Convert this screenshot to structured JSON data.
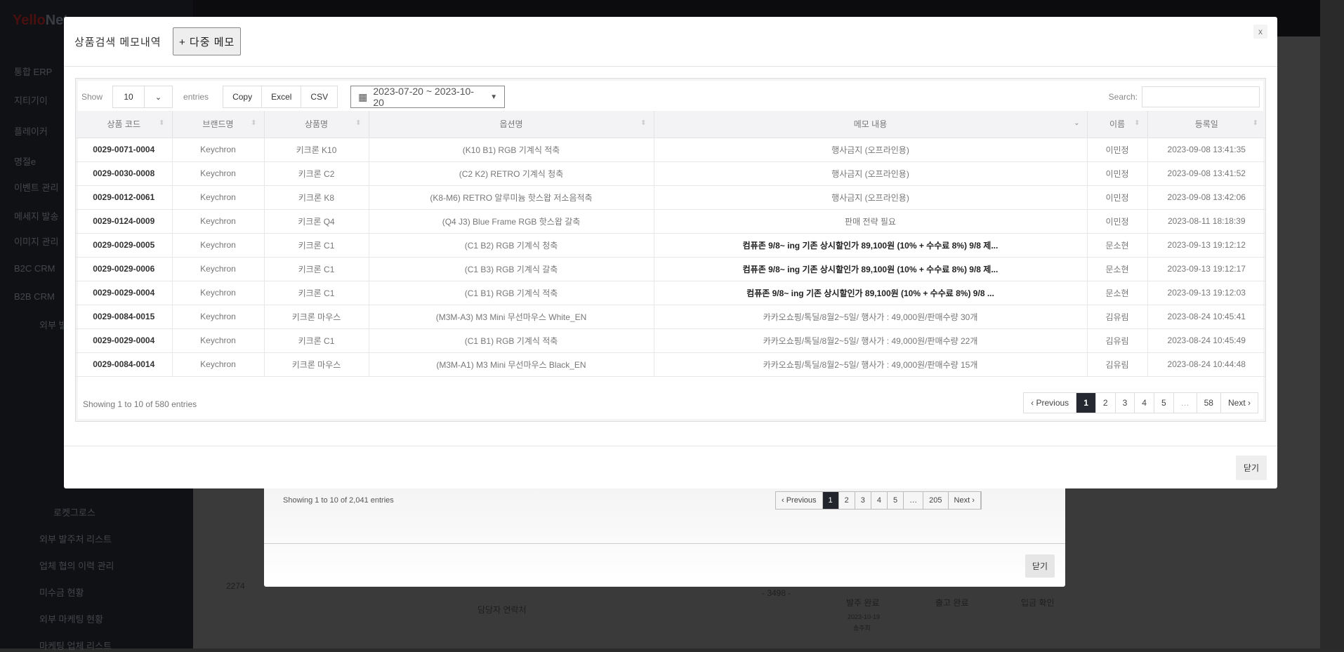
{
  "background": {
    "sidebar": [
      "통합 ERP",
      "지티기이",
      "플레이커",
      "명절e",
      "이벤트 관리",
      "메세지 발송",
      "이미지 관리",
      "B2C CRM",
      "B2B CRM",
      "외부 발주",
      "로켓그로스",
      "외부 발주처 리스트",
      "업체 협의 이력 관리",
      "미수금 현황",
      "외부 마케팅 현황",
      "마케팅 업체 리스트"
    ],
    "modal": {
      "info": "Showing 1 to 10 of 2,041 entries",
      "pages": [
        "‹ Previous",
        "1",
        "2",
        "3",
        "4",
        "5",
        "…",
        "205",
        "Next ›"
      ],
      "close": "닫기"
    },
    "row": {
      "id": "2274",
      "qty": "- 3498 -",
      "contact": "담당자 연락처",
      "s1": "발주 완료",
      "s2": "출고 완료",
      "s3": "입금 확인",
      "date": "2023-10-19",
      "person": "송주희"
    }
  },
  "modal": {
    "title": "상품검색 메모내역",
    "multi_memo": "+ 다중 메모",
    "close_x": "x",
    "show": "Show",
    "length": "10",
    "entries": "entries",
    "buttons": [
      "Copy",
      "Excel",
      "CSV"
    ],
    "daterange": "2023-07-20 ~ 2023-10-20",
    "search_label": "Search:",
    "columns": [
      "상품 코드",
      "브랜드명",
      "상품명",
      "옵션명",
      "메모 내용",
      "이름",
      "등록일"
    ],
    "rows": [
      [
        "0029-0071-0004",
        "Keychron",
        "키크론 K10",
        "(K10 B1) RGB 기계식 적축",
        "행사금지 (오프라인용)",
        "이민정",
        "2023-09-08 13:41:35"
      ],
      [
        "0029-0030-0008",
        "Keychron",
        "키크론 C2",
        "(C2 K2) RETRO 기계식 청축",
        "행사금지 (오프라인용)",
        "이민정",
        "2023-09-08 13:41:52"
      ],
      [
        "0029-0012-0061",
        "Keychron",
        "키크론 K8",
        "(K8-M6) RETRO 알루미늄 핫스왑 저소음적축",
        "행사금지 (오프라인용)",
        "이민정",
        "2023-09-08 13:42:06"
      ],
      [
        "0029-0124-0009",
        "Keychron",
        "키크론 Q4",
        "(Q4 J3) Blue Frame RGB 핫스왑 갈축",
        "판매 전략 필요",
        "이민정",
        "2023-08-11 18:18:39"
      ],
      [
        "0029-0029-0005",
        "Keychron",
        "키크론 C1",
        "(C1 B2) RGB 기계식 청축",
        "컴퓨존 9/8~ ing 기존 상시할인가 89,100원 (10% + 수수료 8%) 9/8 제...",
        "문소현",
        "2023-09-13 19:12:12"
      ],
      [
        "0029-0029-0006",
        "Keychron",
        "키크론 C1",
        "(C1 B3) RGB 기계식 갈축",
        "컴퓨존 9/8~ ing 기존 상시할인가 89,100원 (10% + 수수료 8%) 9/8 제...",
        "문소현",
        "2023-09-13 19:12:17"
      ],
      [
        "0029-0029-0004",
        "Keychron",
        "키크론 C1",
        "(C1 B1) RGB 기계식 적축",
        "컴퓨존 9/8~ ing 기존 상시할인가 89,100원 (10% + 수수료 8%) 9/8 ...",
        "문소현",
        "2023-09-13 19:12:03"
      ],
      [
        "0029-0084-0015",
        "Keychron",
        "키크론 마우스",
        "(M3M-A3) M3 Mini 무선마우스 White_EN",
        "카카오쇼핑/톡딜/8월2~5일/ 행사가 : 49,000원/판매수량 30개",
        "김유림",
        "2023-08-24 10:45:41"
      ],
      [
        "0029-0029-0004",
        "Keychron",
        "키크론 C1",
        "(C1 B1) RGB 기계식 적축",
        "카카오쇼핑/톡딜/8월2~5일/ 행사가 : 49,000원/판매수량 22개",
        "김유림",
        "2023-08-24 10:45:49"
      ],
      [
        "0029-0084-0014",
        "Keychron",
        "키크론 마우스",
        "(M3M-A1) M3 Mini 무선마우스 Black_EN",
        "카카오쇼핑/톡딜/8월2~5일/ 행사가 : 49,000원/판매수량 15개",
        "김유림",
        "2023-08-24 10:44:48"
      ]
    ],
    "bold_memo_rows": [
      4,
      5,
      6
    ],
    "info": "Showing 1 to 10 of 580 entries",
    "pages": [
      "‹  Previous",
      "1",
      "2",
      "3",
      "4",
      "5",
      "…",
      "58",
      "Next  ›"
    ],
    "active_page": "1",
    "close": "닫기"
  }
}
